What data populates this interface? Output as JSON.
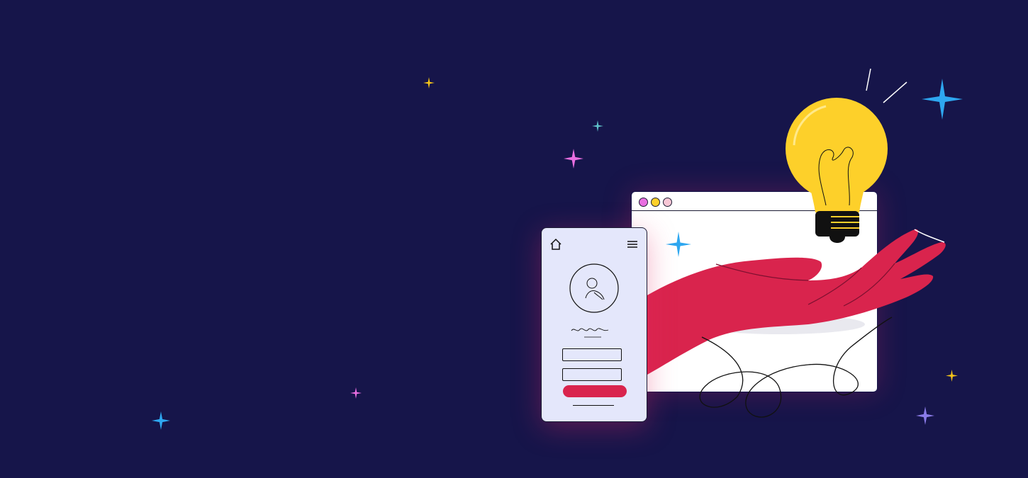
{
  "colors": {
    "background": "#16154a",
    "hand": "#d9244d",
    "bulb": "#fdd02a",
    "phone_screen": "#e4e7fb",
    "button": "#d9244d"
  },
  "icons": [
    "home-icon",
    "menu-icon",
    "user-avatar-icon",
    "lightbulb-icon",
    "sparkle-icon"
  ]
}
